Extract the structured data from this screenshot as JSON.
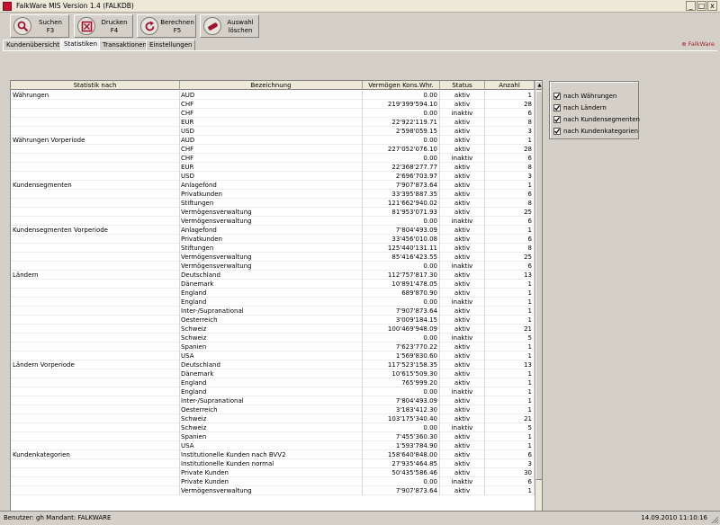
{
  "window": {
    "title": "FalkWare MIS Version 1.4   (FALKDB)",
    "minimize_glyph": "_",
    "maximize_glyph": "□",
    "close_glyph": "x"
  },
  "toolbar": {
    "buttons": [
      {
        "label": "Suchen\nF3",
        "icon": "search-icon"
      },
      {
        "label": "Drucken\nF4",
        "icon": "print-icon"
      },
      {
        "label": "Berechnen\nF5",
        "icon": "refresh-icon"
      },
      {
        "label": "Auswahl\nlöschen",
        "icon": "eraser-icon"
      }
    ]
  },
  "tabs": [
    "Kundenübersicht",
    "Statistiken",
    "Transaktionen",
    "Einstellungen"
  ],
  "active_tab": "Statistiken",
  "brand": "⊕ FalkWare",
  "grid": {
    "columns": [
      "Statistik nach",
      "Bezeichnung",
      "Vermögen Kons.Whr.",
      "Status",
      "Anzahl"
    ],
    "rows": [
      [
        "Währungen",
        "AUD",
        "0.00",
        "aktiv",
        "1"
      ],
      [
        "",
        "CHF",
        "219'399'594.10",
        "aktiv",
        "28"
      ],
      [
        "",
        "CHF",
        "0.00",
        "inaktiv",
        "6"
      ],
      [
        "",
        "EUR",
        "22'922'119.71",
        "aktiv",
        "8"
      ],
      [
        "",
        "USD",
        "2'598'059.15",
        "aktiv",
        "3"
      ],
      [
        "Währungen Vorperiode",
        "AUD",
        "0.00",
        "aktiv",
        "1"
      ],
      [
        "",
        "CHF",
        "227'052'076.10",
        "aktiv",
        "28"
      ],
      [
        "",
        "CHF",
        "0.00",
        "inaktiv",
        "6"
      ],
      [
        "",
        "EUR",
        "22'368'277.77",
        "aktiv",
        "8"
      ],
      [
        "",
        "USD",
        "2'696'703.97",
        "aktiv",
        "3"
      ],
      [
        "Kundensegmenten",
        "Anlagefond",
        "7'907'873.64",
        "aktiv",
        "1"
      ],
      [
        "",
        "Privatkunden",
        "33'395'887.35",
        "aktiv",
        "6"
      ],
      [
        "",
        "Stiftungen",
        "121'662'940.02",
        "aktiv",
        "8"
      ],
      [
        "",
        "Vermögensverwaltung",
        "81'953'071.93",
        "aktiv",
        "25"
      ],
      [
        "",
        "Vermögensverwaltung",
        "0.00",
        "inaktiv",
        "6"
      ],
      [
        "Kundensegmenten Vorperiode",
        "Anlagefond",
        "7'804'493.09",
        "aktiv",
        "1"
      ],
      [
        "",
        "Privatkunden",
        "33'456'010.08",
        "aktiv",
        "6"
      ],
      [
        "",
        "Stiftungen",
        "125'440'131.11",
        "aktiv",
        "8"
      ],
      [
        "",
        "Vermögensverwaltung",
        "85'416'423.55",
        "aktiv",
        "25"
      ],
      [
        "",
        "Vermögensverwaltung",
        "0.00",
        "inaktiv",
        "6"
      ],
      [
        "Ländern",
        "Deutschland",
        "112'757'817.30",
        "aktiv",
        "13"
      ],
      [
        "",
        "Dänemark",
        "10'891'478.05",
        "aktiv",
        "1"
      ],
      [
        "",
        "England",
        "689'870.90",
        "aktiv",
        "1"
      ],
      [
        "",
        "England",
        "0.00",
        "inaktiv",
        "1"
      ],
      [
        "",
        "Inter-/Supranational",
        "7'907'873.64",
        "aktiv",
        "1"
      ],
      [
        "",
        "Oesterreich",
        "3'009'184.15",
        "aktiv",
        "1"
      ],
      [
        "",
        "Schweiz",
        "100'469'948.09",
        "aktiv",
        "21"
      ],
      [
        "",
        "Schweiz",
        "0.00",
        "inaktiv",
        "5"
      ],
      [
        "",
        "Spanien",
        "7'623'770.22",
        "aktiv",
        "1"
      ],
      [
        "",
        "USA",
        "1'569'830.60",
        "aktiv",
        "1"
      ],
      [
        "Ländern Vorperiode",
        "Deutschland",
        "117'523'158.35",
        "aktiv",
        "13"
      ],
      [
        "",
        "Dänemark",
        "10'615'509.30",
        "aktiv",
        "1"
      ],
      [
        "",
        "England",
        "765'999.20",
        "aktiv",
        "1"
      ],
      [
        "",
        "England",
        "0.00",
        "inaktiv",
        "1"
      ],
      [
        "",
        "Inter-/Supranational",
        "7'804'493.09",
        "aktiv",
        "1"
      ],
      [
        "",
        "Oesterreich",
        "3'183'412.30",
        "aktiv",
        "1"
      ],
      [
        "",
        "Schweiz",
        "103'175'340.40",
        "aktiv",
        "21"
      ],
      [
        "",
        "Schweiz",
        "0.00",
        "inaktiv",
        "5"
      ],
      [
        "",
        "Spanien",
        "7'455'360.30",
        "aktiv",
        "1"
      ],
      [
        "",
        "USA",
        "1'593'784.90",
        "aktiv",
        "1"
      ],
      [
        "Kundenkategorien",
        "Institutionelle Kunden nach BVV2",
        "158'640'848.00",
        "aktiv",
        "6"
      ],
      [
        "",
        "Institutionelle Kunden normal",
        "27'935'464.85",
        "aktiv",
        "3"
      ],
      [
        "",
        "Private Kunden",
        "50'435'586.46",
        "aktiv",
        "30"
      ],
      [
        "",
        "Private Kunden",
        "0.00",
        "inaktiv",
        "6"
      ],
      [
        "",
        "Vermögensverwaltung",
        "7'907'873.64",
        "aktiv",
        "1"
      ]
    ]
  },
  "filters": [
    {
      "label": "nach Währungen",
      "checked": true
    },
    {
      "label": "nach Ländern",
      "checked": true
    },
    {
      "label": "nach Kundensegmenten",
      "checked": true
    },
    {
      "label": "nach Kundenkategorien",
      "checked": true
    }
  ],
  "statusbar": {
    "left": "Benutzer: gh  Mandant: FALKWARE",
    "right": "14.09.2010 11:10:16"
  }
}
